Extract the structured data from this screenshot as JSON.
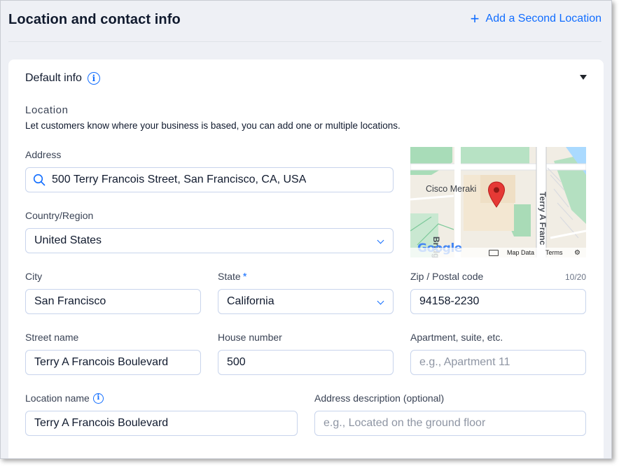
{
  "header": {
    "title": "Location and contact info",
    "add_location_label": "Add a Second Location"
  },
  "section": {
    "title": "Default info",
    "location_title": "Location",
    "location_description": "Let customers know where your business is based, you can add one or multiple locations."
  },
  "fields": {
    "address": {
      "label": "Address",
      "value": "500 Terry Francois Street, San Francisco, CA, USA"
    },
    "country": {
      "label": "Country/Region",
      "value": "United States"
    },
    "city": {
      "label": "City",
      "value": "San Francisco"
    },
    "state": {
      "label": "State",
      "required_mark": "*",
      "value": "California"
    },
    "zip": {
      "label": "Zip / Postal code",
      "counter": "10/20",
      "value": "94158-2230"
    },
    "street": {
      "label": "Street name",
      "value": "Terry A Francois Boulevard"
    },
    "house": {
      "label": "House number",
      "value": "500"
    },
    "apartment": {
      "label": "Apartment, suite, etc.",
      "placeholder": "e.g., Apartment 11"
    },
    "location_name": {
      "label": "Location name",
      "value": "Terry A Francois Boulevard"
    },
    "address_description": {
      "label": "Address description (optional)",
      "placeholder": "e.g., Located on the ground floor"
    }
  },
  "map": {
    "place_label": "Cisco Meraki",
    "street_label_1": "Bridgevie",
    "street_label_2": "Terry A Franc",
    "logo": "Google",
    "map_data_label": "Map Data",
    "terms_label": "Terms",
    "pin_color": "#e53935"
  },
  "colors": {
    "accent": "#116dff",
    "page_bg": "#eef0f5",
    "card_bg": "#ffffff",
    "field_border": "#c8d4ec"
  },
  "icons": {
    "add": "plus-icon",
    "info": "info-icon",
    "collapse": "caret-down-icon",
    "search": "search-icon",
    "dropdown": "chevron-down-icon"
  }
}
